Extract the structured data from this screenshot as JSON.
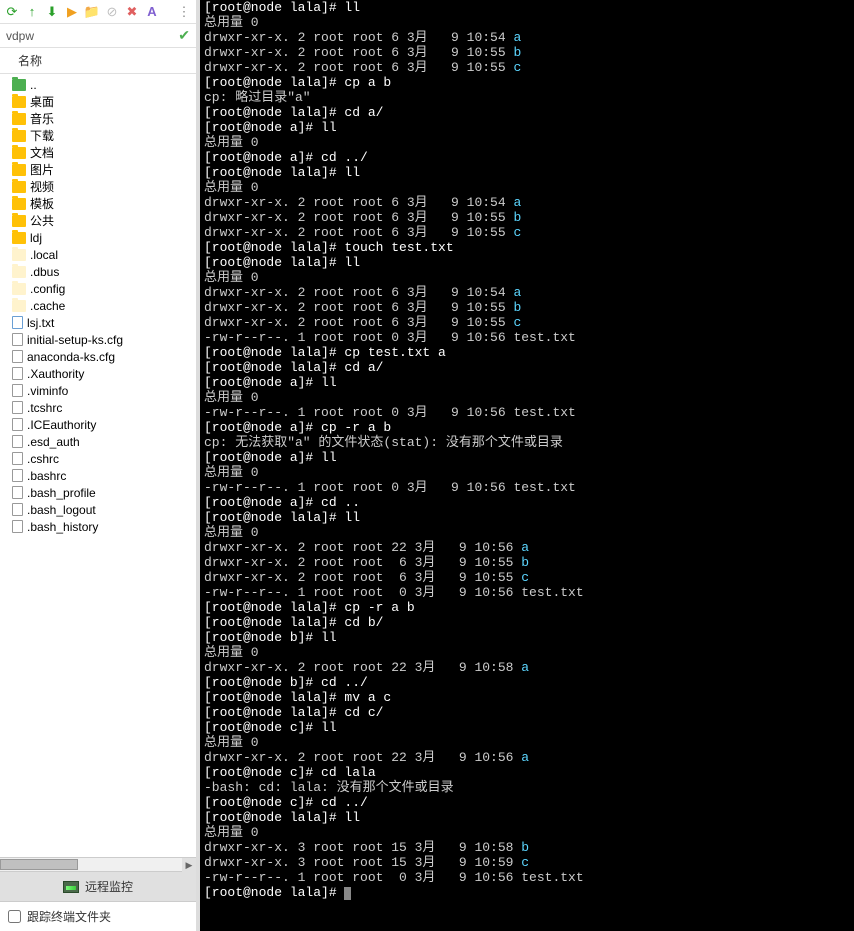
{
  "toolbar": {
    "icons": [
      "refresh-icon",
      "up-arrow-icon",
      "download-icon",
      "play-icon",
      "new-folder-icon",
      "delete1-icon",
      "delete2-icon",
      "font-icon"
    ]
  },
  "path": {
    "value": "vdpw"
  },
  "tree_header": "名称",
  "tree_items": [
    {
      "icon": "folder-up",
      "label": ".."
    },
    {
      "icon": "folder",
      "label": "桌面"
    },
    {
      "icon": "folder",
      "label": "音乐"
    },
    {
      "icon": "folder",
      "label": "下载"
    },
    {
      "icon": "folder",
      "label": "文档"
    },
    {
      "icon": "folder",
      "label": "图片"
    },
    {
      "icon": "folder",
      "label": "视频"
    },
    {
      "icon": "folder",
      "label": "模板"
    },
    {
      "icon": "folder",
      "label": "公共"
    },
    {
      "icon": "folder",
      "label": "ldj"
    },
    {
      "icon": "folder-hidden",
      "label": ".local"
    },
    {
      "icon": "folder-hidden",
      "label": ".dbus"
    },
    {
      "icon": "folder-hidden",
      "label": ".config"
    },
    {
      "icon": "folder-hidden",
      "label": ".cache"
    },
    {
      "icon": "file-txt",
      "label": "lsj.txt"
    },
    {
      "icon": "file",
      "label": "initial-setup-ks.cfg"
    },
    {
      "icon": "file",
      "label": "anaconda-ks.cfg"
    },
    {
      "icon": "file",
      "label": ".Xauthority"
    },
    {
      "icon": "file",
      "label": ".viminfo"
    },
    {
      "icon": "file",
      "label": ".tcshrc"
    },
    {
      "icon": "file",
      "label": ".ICEauthority"
    },
    {
      "icon": "file",
      "label": ".esd_auth"
    },
    {
      "icon": "file",
      "label": ".cshrc"
    },
    {
      "icon": "file",
      "label": ".bashrc"
    },
    {
      "icon": "file",
      "label": ".bash_profile"
    },
    {
      "icon": "file",
      "label": ".bash_logout"
    },
    {
      "icon": "file",
      "label": ".bash_history"
    }
  ],
  "remote_label": "远程监控",
  "follow_label": "跟踪终端文件夹",
  "terminal_lines": [
    [
      {
        "t": "[root@node lala]# ll",
        "c": "w"
      }
    ],
    [
      {
        "t": "总用量 0",
        "c": "g"
      }
    ],
    [
      {
        "t": "drwxr-xr-x. 2 root root 6 3月   9 10:54 ",
        "c": "g"
      },
      {
        "t": "a",
        "c": "c"
      }
    ],
    [
      {
        "t": "drwxr-xr-x. 2 root root 6 3月   9 10:55 ",
        "c": "g"
      },
      {
        "t": "b",
        "c": "c"
      }
    ],
    [
      {
        "t": "drwxr-xr-x. 2 root root 6 3月   9 10:55 ",
        "c": "g"
      },
      {
        "t": "c",
        "c": "c"
      }
    ],
    [
      {
        "t": "[root@node lala]# cp a b",
        "c": "w"
      }
    ],
    [
      {
        "t": "cp: 略过目录\"a\"",
        "c": "g"
      }
    ],
    [
      {
        "t": "[root@node lala]# cd a/",
        "c": "w"
      }
    ],
    [
      {
        "t": "[root@node a]# ll",
        "c": "w"
      }
    ],
    [
      {
        "t": "总用量 0",
        "c": "g"
      }
    ],
    [
      {
        "t": "[root@node a]# cd ../",
        "c": "w"
      }
    ],
    [
      {
        "t": "[root@node lala]# ll",
        "c": "w"
      }
    ],
    [
      {
        "t": "总用量 0",
        "c": "g"
      }
    ],
    [
      {
        "t": "drwxr-xr-x. 2 root root 6 3月   9 10:54 ",
        "c": "g"
      },
      {
        "t": "a",
        "c": "c"
      }
    ],
    [
      {
        "t": "drwxr-xr-x. 2 root root 6 3月   9 10:55 ",
        "c": "g"
      },
      {
        "t": "b",
        "c": "c"
      }
    ],
    [
      {
        "t": "drwxr-xr-x. 2 root root 6 3月   9 10:55 ",
        "c": "g"
      },
      {
        "t": "c",
        "c": "c"
      }
    ],
    [
      {
        "t": "[root@node lala]# touch test.txt",
        "c": "w"
      }
    ],
    [
      {
        "t": "[root@node lala]# ll",
        "c": "w"
      }
    ],
    [
      {
        "t": "总用量 0",
        "c": "g"
      }
    ],
    [
      {
        "t": "drwxr-xr-x. 2 root root 6 3月   9 10:54 ",
        "c": "g"
      },
      {
        "t": "a",
        "c": "c"
      }
    ],
    [
      {
        "t": "drwxr-xr-x. 2 root root 6 3月   9 10:55 ",
        "c": "g"
      },
      {
        "t": "b",
        "c": "c"
      }
    ],
    [
      {
        "t": "drwxr-xr-x. 2 root root 6 3月   9 10:55 ",
        "c": "g"
      },
      {
        "t": "c",
        "c": "c"
      }
    ],
    [
      {
        "t": "-rw-r--r--. 1 root root 0 3月   9 10:56 test.txt",
        "c": "g"
      }
    ],
    [
      {
        "t": "[root@node lala]# cp test.txt a",
        "c": "w"
      }
    ],
    [
      {
        "t": "[root@node lala]# cd a/",
        "c": "w"
      }
    ],
    [
      {
        "t": "[root@node a]# ll",
        "c": "w"
      }
    ],
    [
      {
        "t": "总用量 0",
        "c": "g"
      }
    ],
    [
      {
        "t": "-rw-r--r--. 1 root root 0 3月   9 10:56 test.txt",
        "c": "g"
      }
    ],
    [
      {
        "t": "[root@node a]# cp -r a b",
        "c": "w"
      }
    ],
    [
      {
        "t": "cp: 无法获取\"a\" 的文件状态(stat): 没有那个文件或目录",
        "c": "g"
      }
    ],
    [
      {
        "t": "[root@node a]# ll",
        "c": "w"
      }
    ],
    [
      {
        "t": "总用量 0",
        "c": "g"
      }
    ],
    [
      {
        "t": "-rw-r--r--. 1 root root 0 3月   9 10:56 test.txt",
        "c": "g"
      }
    ],
    [
      {
        "t": "[root@node a]# cd ..",
        "c": "w"
      }
    ],
    [
      {
        "t": "[root@node lala]# ll",
        "c": "w"
      }
    ],
    [
      {
        "t": "总用量 0",
        "c": "g"
      }
    ],
    [
      {
        "t": "drwxr-xr-x. 2 root root 22 3月   9 10:56 ",
        "c": "g"
      },
      {
        "t": "a",
        "c": "c"
      }
    ],
    [
      {
        "t": "drwxr-xr-x. 2 root root  6 3月   9 10:55 ",
        "c": "g"
      },
      {
        "t": "b",
        "c": "c"
      }
    ],
    [
      {
        "t": "drwxr-xr-x. 2 root root  6 3月   9 10:55 ",
        "c": "g"
      },
      {
        "t": "c",
        "c": "c"
      }
    ],
    [
      {
        "t": "-rw-r--r--. 1 root root  0 3月   9 10:56 test.txt",
        "c": "g"
      }
    ],
    [
      {
        "t": "[root@node lala]# cp -r a b",
        "c": "w"
      }
    ],
    [
      {
        "t": "[root@node lala]# cd b/",
        "c": "w"
      }
    ],
    [
      {
        "t": "[root@node b]# ll",
        "c": "w"
      }
    ],
    [
      {
        "t": "总用量 0",
        "c": "g"
      }
    ],
    [
      {
        "t": "drwxr-xr-x. 2 root root 22 3月   9 10:58 ",
        "c": "g"
      },
      {
        "t": "a",
        "c": "c"
      }
    ],
    [
      {
        "t": "[root@node b]# cd ../",
        "c": "w"
      }
    ],
    [
      {
        "t": "[root@node lala]# mv a c",
        "c": "w"
      }
    ],
    [
      {
        "t": "[root@node lala]# cd c/",
        "c": "w"
      }
    ],
    [
      {
        "t": "[root@node c]# ll",
        "c": "w"
      }
    ],
    [
      {
        "t": "总用量 0",
        "c": "g"
      }
    ],
    [
      {
        "t": "drwxr-xr-x. 2 root root 22 3月   9 10:56 ",
        "c": "g"
      },
      {
        "t": "a",
        "c": "c"
      }
    ],
    [
      {
        "t": "[root@node c]# cd lala",
        "c": "w"
      }
    ],
    [
      {
        "t": "-bash: cd: lala: 没有那个文件或目录",
        "c": "g"
      }
    ],
    [
      {
        "t": "[root@node c]# cd ../",
        "c": "w"
      }
    ],
    [
      {
        "t": "[root@node lala]# ll",
        "c": "w"
      }
    ],
    [
      {
        "t": "总用量 0",
        "c": "g"
      }
    ],
    [
      {
        "t": "drwxr-xr-x. 3 root root 15 3月   9 10:58 ",
        "c": "g"
      },
      {
        "t": "b",
        "c": "c"
      }
    ],
    [
      {
        "t": "drwxr-xr-x. 3 root root 15 3月   9 10:59 ",
        "c": "g"
      },
      {
        "t": "c",
        "c": "c"
      }
    ],
    [
      {
        "t": "-rw-r--r--. 1 root root  0 3月   9 10:56 test.txt",
        "c": "g"
      }
    ],
    [
      {
        "t": "[root@node lala]# ",
        "c": "w"
      },
      {
        "t": "CURSOR",
        "c": "cursor"
      }
    ]
  ]
}
